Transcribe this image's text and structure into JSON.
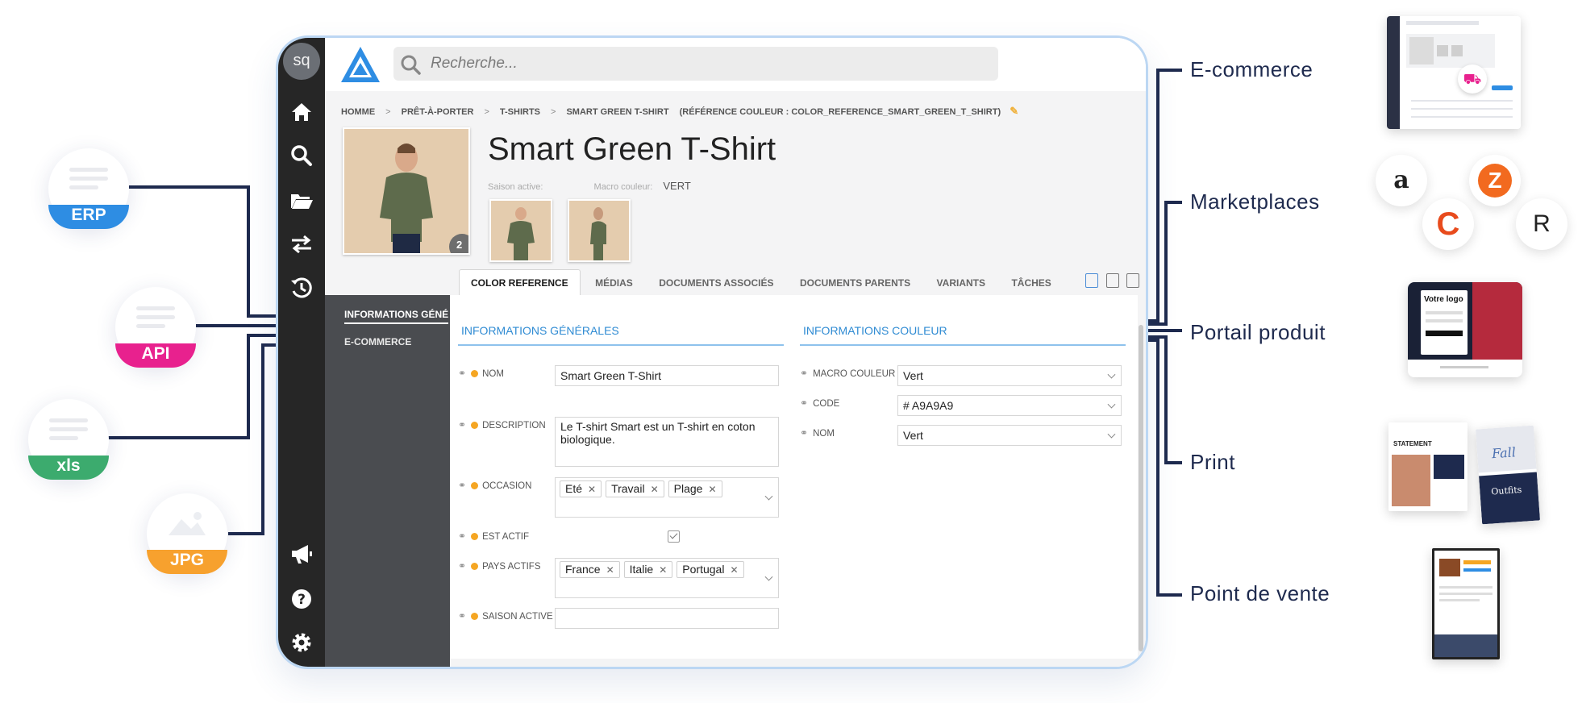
{
  "sources": [
    {
      "label": "ERP",
      "color": "#2e8de3"
    },
    {
      "label": "API",
      "color": "#e8218e"
    },
    {
      "label": "xls",
      "color": "#3cab6e"
    },
    {
      "label": "JPG",
      "color": "#f7a12e"
    }
  ],
  "sidebar": {
    "avatar": "sq",
    "icons": [
      "home-icon",
      "search-icon",
      "folder-icon",
      "transfer-icon",
      "history-icon",
      "megaphone-icon",
      "help-icon",
      "settings-icon"
    ]
  },
  "search": {
    "placeholder": "Recherche..."
  },
  "breadcrumb": {
    "items": [
      "HOMME",
      "PRÊT-À-PORTER",
      "T-SHIRTS",
      "SMART GREEN T-SHIRT"
    ],
    "separator": ">",
    "reference": "(RÉFÉRENCE COULEUR : COLOR_REFERENCE_SMART_GREEN_T_SHIRT)"
  },
  "product": {
    "title": "Smart Green T-Shirt",
    "season_label": "Saison active:",
    "macro_label": "Macro couleur:",
    "macro_value": "VERT",
    "image_count": "2"
  },
  "tabs": [
    "COLOR REFERENCE",
    "MÉDIAS",
    "DOCUMENTS ASSOCIÉS",
    "DOCUMENTS PARENTS",
    "VARIANTS",
    "TÂCHES"
  ],
  "subnav": [
    "INFORMATIONS GÉNÉ",
    "E-COMMERCE"
  ],
  "general": {
    "title": "INFORMATIONS GÉNÉRALES",
    "nom_label": "NOM",
    "nom_value": "Smart Green T-Shirt",
    "description_label": "DESCRIPTION",
    "description_value": "Le T-shirt Smart est un T-shirt en coton biologique.",
    "occasion_label": "OCCASION",
    "occasion_values": [
      "Eté",
      "Travail",
      "Plage"
    ],
    "actif_label": "EST ACTIF",
    "pays_label": "PAYS ACTIFS",
    "pays_values": [
      "France",
      "Italie",
      "Portugal"
    ],
    "saison_label": "SAISON ACTIVE",
    "saison_value": ""
  },
  "couleur": {
    "title": "INFORMATIONS COULEUR",
    "macro_label": "MACRO COULEUR",
    "macro_value": "Vert",
    "code_label": "CODE",
    "code_value": "# A9A9A9",
    "nom_label": "NOM",
    "nom_value": "Vert"
  },
  "channels": [
    "E-commerce",
    "Marketplaces",
    "Portail produit",
    "Print",
    "Point de vente"
  ],
  "marketplace_logos": [
    "a",
    "Z",
    "C",
    "R"
  ],
  "portal_mock": {
    "logo_text": "Votre logo"
  },
  "print_mock": {
    "left_title": "STATEMENT",
    "right_title": "Outfits",
    "script": "Fall"
  },
  "colors": {
    "accent": "#2f8bd3",
    "required_dot": "#f5a623",
    "navy": "#1e2a4e",
    "rail": "#262626"
  }
}
